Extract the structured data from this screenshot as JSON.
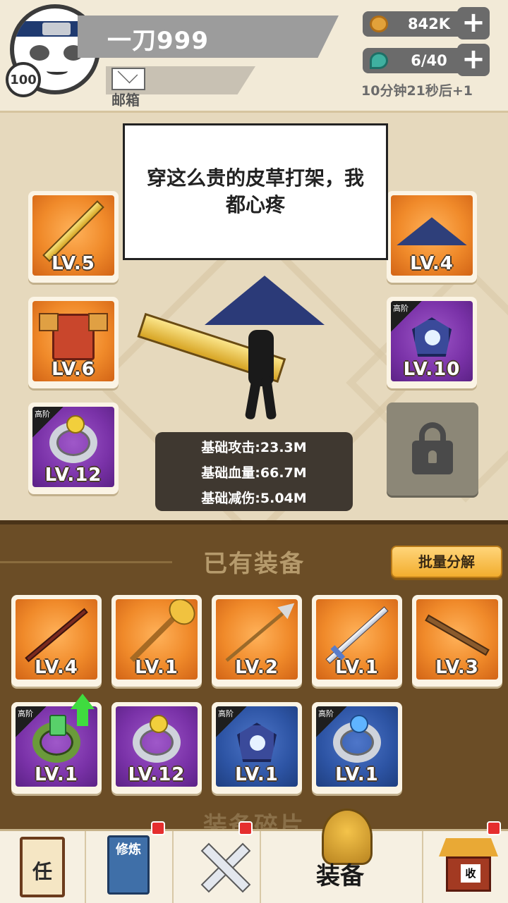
{
  "player": {
    "name": "一刀999",
    "level": "100",
    "mail_label": "邮箱"
  },
  "resources": {
    "coins": "842K",
    "stamina": "6/40",
    "refill_timer": "10分钟21秒后+1"
  },
  "character": {
    "speech": "穿这么贵的皮草打架，我都心疼",
    "stats": [
      "基础攻击:23.3M",
      "基础血量:66.7M",
      "基础减伤:5.04M"
    ],
    "left_slots": [
      {
        "item": "golden-sword",
        "level": "LV.5",
        "rarity": "orange",
        "tier": ""
      },
      {
        "item": "armor",
        "level": "LV.6",
        "rarity": "orange",
        "tier": ""
      },
      {
        "item": "ring",
        "level": "LV.12",
        "rarity": "purple",
        "tier": "高阶"
      }
    ],
    "right_slots": [
      {
        "item": "straw-hat",
        "level": "LV.4",
        "rarity": "orange",
        "tier": ""
      },
      {
        "item": "amulet",
        "level": "LV.10",
        "rarity": "purple",
        "tier": "高阶"
      }
    ],
    "locked_slot_icon": "padlock-icon"
  },
  "inventory": {
    "title": "已有装备",
    "bulk_button": "批量分解",
    "items": [
      {
        "item": "staff",
        "level": "LV.4",
        "rarity": "orange",
        "tier": ""
      },
      {
        "item": "mace",
        "level": "LV.1",
        "rarity": "orange",
        "tier": ""
      },
      {
        "item": "spear",
        "level": "LV.2",
        "rarity": "orange",
        "tier": ""
      },
      {
        "item": "sword",
        "level": "LV.1",
        "rarity": "orange",
        "tier": ""
      },
      {
        "item": "flute",
        "level": "LV.3",
        "rarity": "orange",
        "tier": ""
      },
      {
        "item": "green-bracelet",
        "level": "LV.1",
        "rarity": "purple",
        "tier": "高阶",
        "upgrade": true
      },
      {
        "item": "ring",
        "level": "LV.12",
        "rarity": "purple",
        "tier": ""
      },
      {
        "item": "amulet",
        "level": "LV.1",
        "rarity": "blue",
        "tier": "高阶"
      },
      {
        "item": "blue-ring",
        "level": "LV.1",
        "rarity": "blue",
        "tier": "高阶"
      }
    ],
    "shards_title": "装备碎片"
  },
  "nav": {
    "task": "任",
    "cultivate": "修炼",
    "equipment": "装备",
    "collect": "收"
  }
}
